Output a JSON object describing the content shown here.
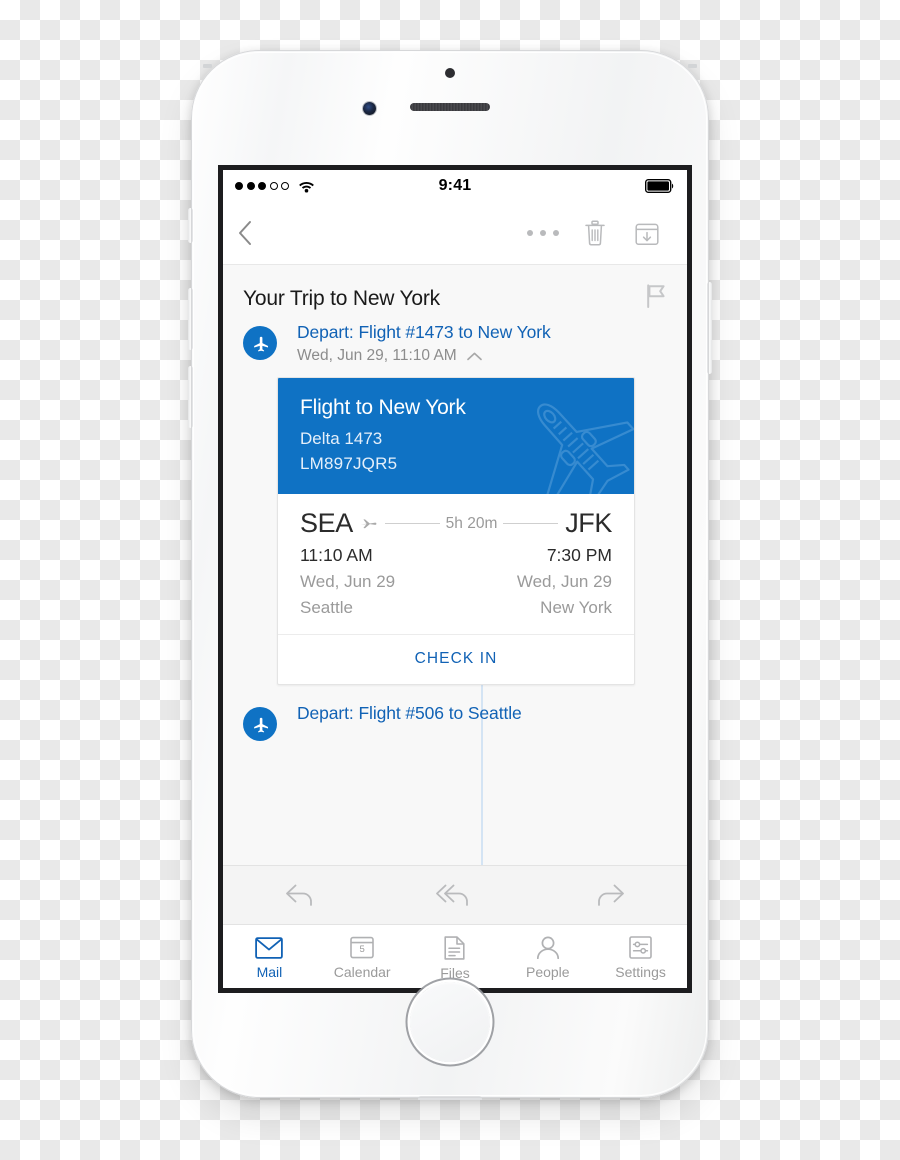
{
  "status_bar": {
    "time": "9:41",
    "signal_dots_total": 5,
    "signal_dots_filled": 3,
    "wifi_icon": "wifi-icon",
    "battery_icon": "battery-full-icon"
  },
  "nav_bar": {
    "back_icon": "chevron-left-icon",
    "more_icon": "ellipsis-icon",
    "delete_icon": "trash-icon",
    "archive_icon": "archive-down-icon"
  },
  "message": {
    "subject": "Your Trip to New York",
    "flag_icon": "flag-icon"
  },
  "entries": [
    {
      "badge_icon": "airplane-icon",
      "title": "Depart: Flight #1473 to New York",
      "subtitle": "Wed, Jun 29, 11:10 AM",
      "collapse_icon": "chevron-up-icon"
    },
    {
      "badge_icon": "airplane-icon",
      "title": "Depart: Flight #506 to Seattle"
    }
  ],
  "flight_card": {
    "header": {
      "title": "Flight to New York",
      "airline": "Delta 1473",
      "confirmation": "LM897JQR5",
      "watermark_icon": "airplane-outline-icon"
    },
    "route": {
      "origin_code": "SEA",
      "destination_code": "JFK",
      "duration": "5h 20m",
      "duration_icon": "airplane-small-icon",
      "depart_time": "11:10 AM",
      "arrive_time": "7:30 PM",
      "depart_date": "Wed, Jun 29",
      "arrive_date": "Wed, Jun 29",
      "origin_city": "Seattle",
      "destination_city": "New York"
    },
    "action_label": "CHECK IN"
  },
  "reply_toolbar": [
    {
      "name": "reply",
      "icon": "reply-arrow-icon"
    },
    {
      "name": "reply-all",
      "icon": "reply-all-arrow-icon"
    },
    {
      "name": "forward",
      "icon": "forward-arrow-icon"
    }
  ],
  "tab_bar": {
    "tabs": [
      {
        "label": "Mail",
        "icon": "envelope-icon",
        "active": true
      },
      {
        "label": "Calendar",
        "icon": "calendar-icon",
        "badge_day": "5",
        "active": false
      },
      {
        "label": "Files",
        "icon": "document-icon",
        "active": false
      },
      {
        "label": "People",
        "icon": "person-icon",
        "active": false
      },
      {
        "label": "Settings",
        "icon": "sliders-icon",
        "active": false
      }
    ]
  },
  "colors": {
    "accent_blue": "#0f72c4",
    "link_blue": "#1162b5",
    "muted_gray": "#9a9a9a",
    "content_bg": "#f8f8f8"
  }
}
